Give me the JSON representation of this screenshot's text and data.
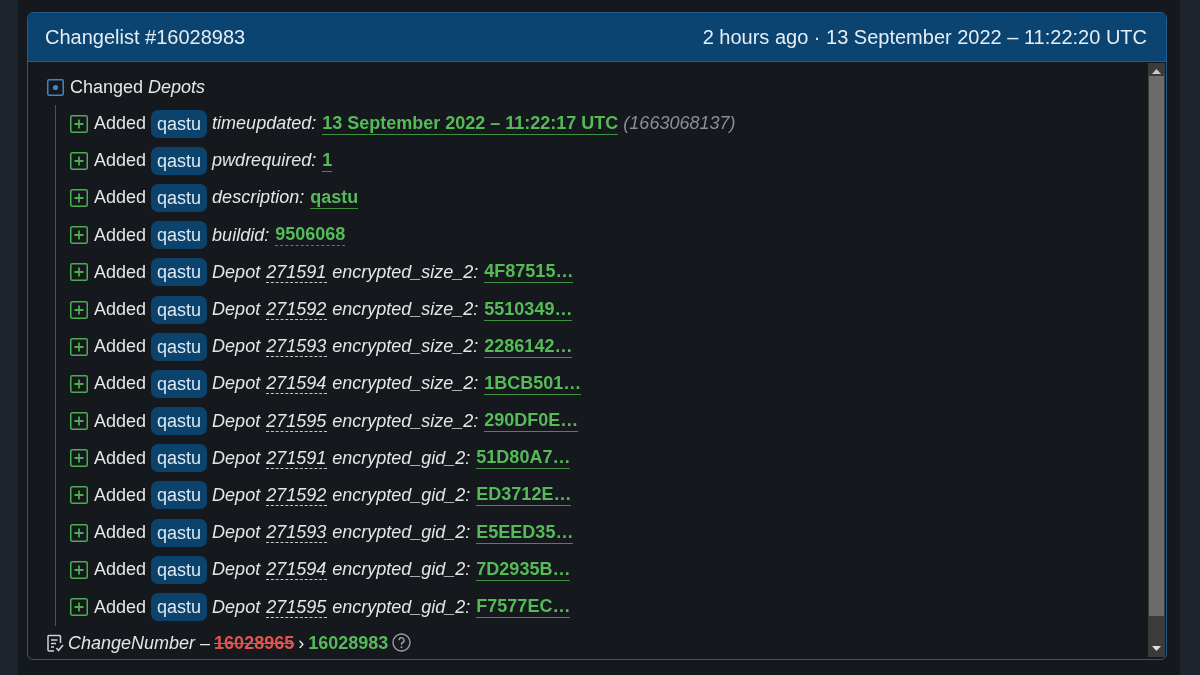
{
  "header": {
    "title": "Changelist #16028983",
    "time": "2 hours ago · 13 September 2022 – 11:22:20 UTC"
  },
  "depots": {
    "label": "Changed *Depots*",
    "expanded": true,
    "changes": [
      {
        "kind": "field",
        "action": "Added",
        "tag": "qastu",
        "key": "timeupdated:",
        "value": "13 September 2022 – 11:22:17 UTC",
        "dashed": false,
        "note": "(1663068137)"
      },
      {
        "kind": "field",
        "action": "Added",
        "tag": "qastu",
        "key": "pwdrequired:",
        "value": "1",
        "dashed": false
      },
      {
        "kind": "field",
        "action": "Added",
        "tag": "qastu",
        "key": "description:",
        "value": "qastu",
        "dashed": false
      },
      {
        "kind": "field",
        "action": "Added",
        "tag": "qastu",
        "key": "buildid:",
        "value": "9506068",
        "dashed": true
      },
      {
        "kind": "depot",
        "action": "Added",
        "tag": "qastu",
        "depot_label": "Depot",
        "depot": "271591",
        "key": "encrypted_size_2:",
        "value": "4F87515…",
        "dashed": false
      },
      {
        "kind": "depot",
        "action": "Added",
        "tag": "qastu",
        "depot_label": "Depot",
        "depot": "271592",
        "key": "encrypted_size_2:",
        "value": "5510349…",
        "dashed": false
      },
      {
        "kind": "depot",
        "action": "Added",
        "tag": "qastu",
        "depot_label": "Depot",
        "depot": "271593",
        "key": "encrypted_size_2:",
        "value": "2286142…",
        "dashed": false
      },
      {
        "kind": "depot",
        "action": "Added",
        "tag": "qastu",
        "depot_label": "Depot",
        "depot": "271594",
        "key": "encrypted_size_2:",
        "value": "1BCB501…",
        "dashed": false
      },
      {
        "kind": "depot",
        "action": "Added",
        "tag": "qastu",
        "depot_label": "Depot",
        "depot": "271595",
        "key": "encrypted_size_2:",
        "value": "290DF0E…",
        "dashed": false
      },
      {
        "kind": "depot",
        "action": "Added",
        "tag": "qastu",
        "depot_label": "Depot",
        "depot": "271591",
        "key": "encrypted_gid_2:",
        "value": "51D80A7…",
        "dashed": false
      },
      {
        "kind": "depot",
        "action": "Added",
        "tag": "qastu",
        "depot_label": "Depot",
        "depot": "271592",
        "key": "encrypted_gid_2:",
        "value": "ED3712E…",
        "dashed": false
      },
      {
        "kind": "depot",
        "action": "Added",
        "tag": "qastu",
        "depot_label": "Depot",
        "depot": "271593",
        "key": "encrypted_gid_2:",
        "value": "E5EED35…",
        "dashed": false
      },
      {
        "kind": "depot",
        "action": "Added",
        "tag": "qastu",
        "depot_label": "Depot",
        "depot": "271594",
        "key": "encrypted_gid_2:",
        "value": "7D2935B…",
        "dashed": false
      },
      {
        "kind": "depot",
        "action": "Added",
        "tag": "qastu",
        "depot_label": "Depot",
        "depot": "271595",
        "key": "encrypted_gid_2:",
        "value": "F7577EC…",
        "dashed": false
      }
    ]
  },
  "change_number": {
    "key": "ChangeNumber",
    "dash": "–",
    "old": "16028965",
    "arrow": "›",
    "new": "16028983"
  }
}
